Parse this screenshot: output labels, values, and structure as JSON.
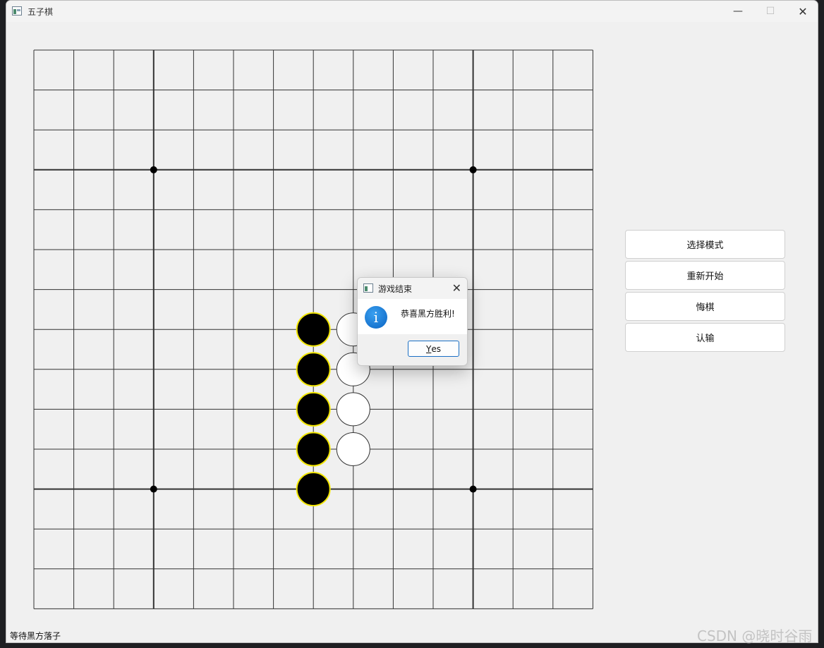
{
  "window": {
    "title": "五子棋",
    "min_glyph": "—",
    "max_glyph": "☐",
    "close_glyph": "✕"
  },
  "board": {
    "size": 15,
    "star_points": [
      [
        3,
        3
      ],
      [
        3,
        11
      ],
      [
        11,
        3
      ],
      [
        11,
        11
      ]
    ],
    "stones": [
      {
        "color": "black",
        "row": 7,
        "col": 7,
        "highlight": true
      },
      {
        "color": "black",
        "row": 8,
        "col": 7,
        "highlight": true
      },
      {
        "color": "black",
        "row": 9,
        "col": 7,
        "highlight": true
      },
      {
        "color": "black",
        "row": 10,
        "col": 7,
        "highlight": true
      },
      {
        "color": "black",
        "row": 11,
        "col": 7,
        "highlight": true
      },
      {
        "color": "white",
        "row": 7,
        "col": 8,
        "highlight": false
      },
      {
        "color": "white",
        "row": 8,
        "col": 8,
        "highlight": false
      },
      {
        "color": "white",
        "row": 9,
        "col": 8,
        "highlight": false
      },
      {
        "color": "white",
        "row": 10,
        "col": 8,
        "highlight": false
      }
    ],
    "colors": {
      "line": "#333333",
      "highlight": "#f2e600",
      "black_stone": "#000000",
      "white_stone": "#ffffff"
    }
  },
  "side_panel": {
    "buttons": [
      "选择模式",
      "重新开始",
      "悔棋",
      "认输"
    ]
  },
  "status": "等待黑方落子",
  "dialog": {
    "title": "游戏结束",
    "message": "恭喜黑方胜利!",
    "button_label_rest": "es",
    "button_mnemonic": "Y",
    "icon": "info-icon"
  },
  "watermark": "CSDN @晓时谷雨"
}
